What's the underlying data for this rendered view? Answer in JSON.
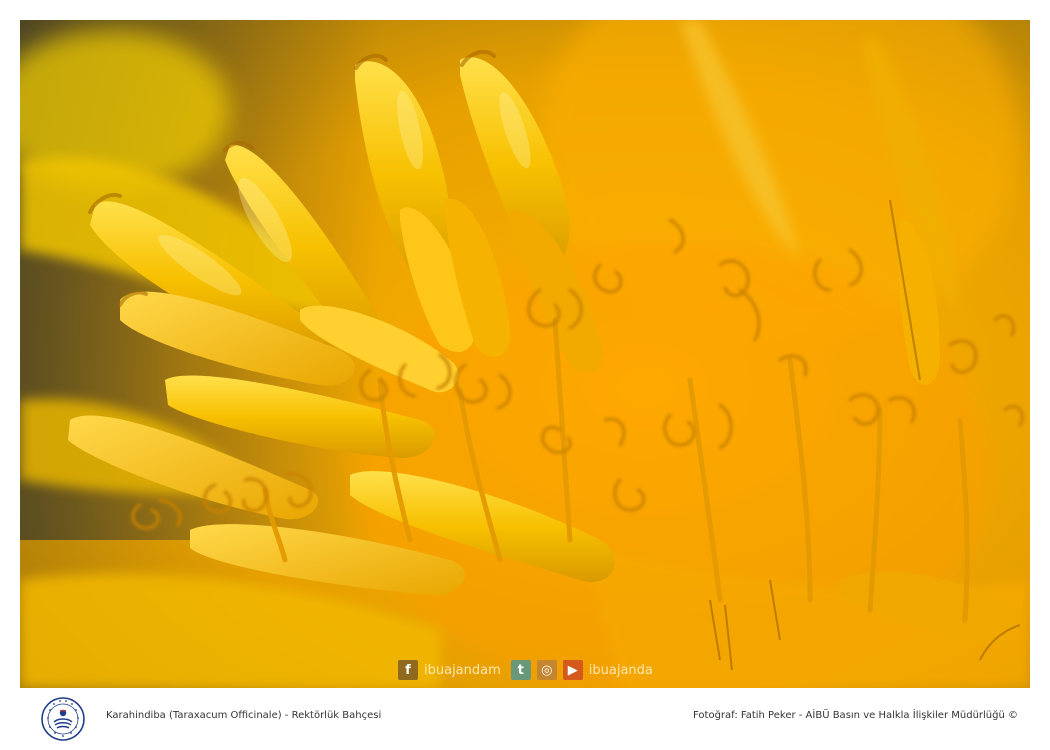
{
  "photo": {
    "subject": "dandelion-flower-macro",
    "colors": {
      "petal_light": "#ffd21a",
      "petal_mid": "#f2b400",
      "petal_deep": "#c98400",
      "background_dark": "#4a4228"
    }
  },
  "social": {
    "facebook_icon_glyph": "f",
    "facebook_handle": "ibuajandam",
    "twitter_icon_glyph": "t",
    "instagram_icon_glyph": "◎",
    "youtube_icon_glyph": "▶",
    "youtube_handle": "ibuajanda"
  },
  "footer": {
    "logo_name": "university-seal-icon",
    "caption": "Karahindiba (Taraxacum Officinale) - Rektörlük Bahçesi",
    "credit": "Fotoğraf: Fatih Peker - AİBÜ Basın ve Halkla İlişkiler Müdürlüğü ©"
  }
}
